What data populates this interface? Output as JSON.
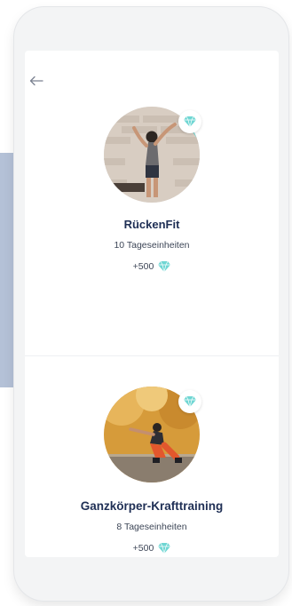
{
  "navigation": {
    "back_icon": "arrow-left-icon"
  },
  "programs": [
    {
      "title": "RückenFit",
      "units": "10 Tageseinheiten",
      "points": "+500",
      "image_icon": "stretching-photo"
    },
    {
      "title": "Ganzkörper-Krafttraining",
      "units": "8 Tageseinheiten",
      "points": "+500",
      "image_icon": "squat-photo"
    }
  ],
  "colors": {
    "title": "#1f2f55",
    "accent_gem": "#6fd6d3",
    "side_panel": "#b4c1d7"
  }
}
